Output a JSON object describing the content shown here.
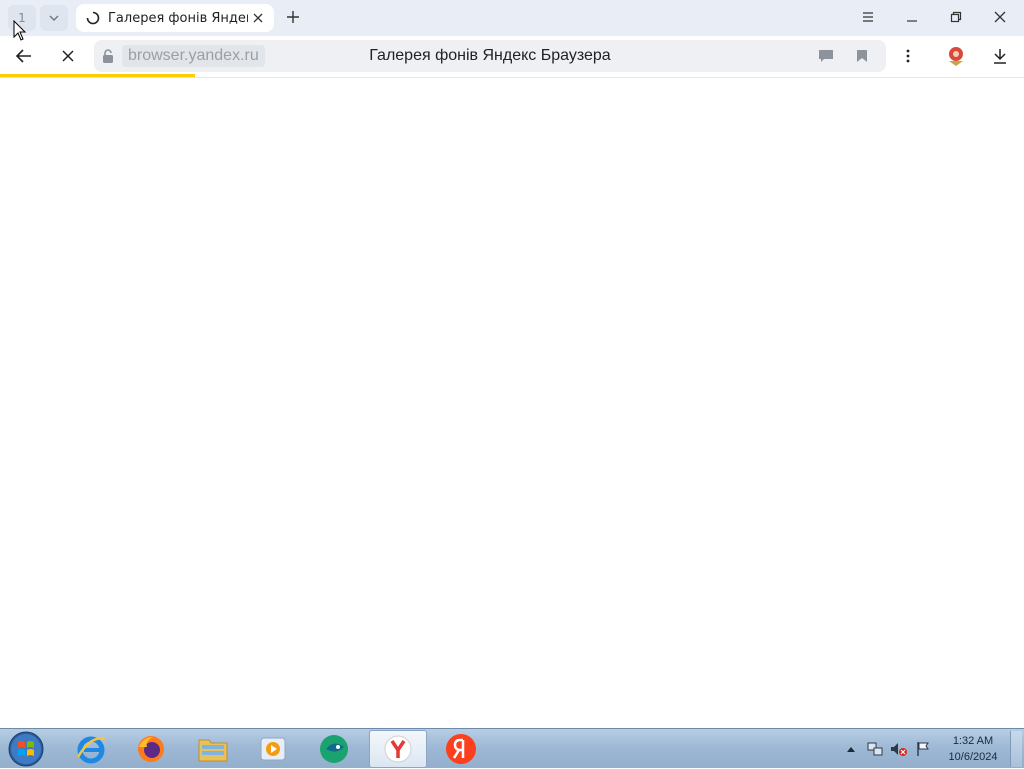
{
  "browser": {
    "tab_counter": "1",
    "tabs": [
      {
        "title": "Галерея фонів Яндекс Браузера",
        "loading": true
      }
    ],
    "address": {
      "domain": "browser.yandex.ru",
      "page_title": "Галерея фонів Яндекс Браузера"
    },
    "loading_progress_percent": 19,
    "colors": {
      "progress": "#ffcc00",
      "tabstrip": "#e9eef6",
      "omnibox": "#eef0f3"
    },
    "icons": [
      "tab-list-chevron-icon",
      "loading-spinner-icon",
      "close-icon",
      "plus-icon",
      "menu-icon",
      "minimize-icon",
      "restore-icon",
      "close-window-icon",
      "back-arrow-icon",
      "stop-icon",
      "lock-icon",
      "reviews-icon",
      "bookmark-icon",
      "more-vertical-icon",
      "extension-icon",
      "download-icon"
    ]
  },
  "taskbar": {
    "apps": [
      "internet-explorer",
      "firefox",
      "file-explorer",
      "media-player",
      "chat-app",
      "yandex-browser",
      "yandex"
    ],
    "clock": {
      "time": "1:32 AM",
      "date": "10/6/2024"
    }
  }
}
